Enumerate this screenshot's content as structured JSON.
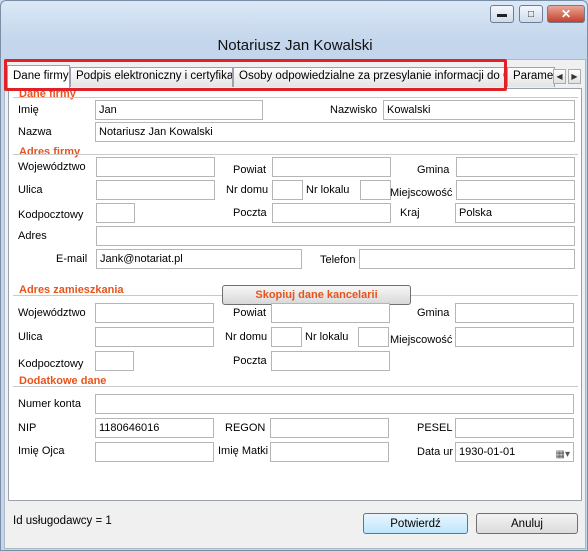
{
  "window": {
    "title": "Notariusz Jan Kowalski",
    "controls": {
      "minimize": "▬",
      "maximize": "□",
      "close": "✕"
    }
  },
  "tabs": [
    {
      "label": "Dane firmy"
    },
    {
      "label": "Podpis elektroniczny i certyfikaty"
    },
    {
      "label": "Osoby odpowiedzialne za przesylanie informacji do GIIF"
    },
    {
      "label": "Paramet"
    }
  ],
  "tab_scroll": {
    "left": "◀",
    "right": "▶"
  },
  "firm": {
    "section": "Dane firmy",
    "imie_label": "Imię",
    "imie_value": "Jan",
    "nazwisko_label": "Nazwisko",
    "nazwisko_value": "Kowalski",
    "nazwa_label": "Nazwa",
    "nazwa_value": "Notariusz Jan Kowalski"
  },
  "firm_address": {
    "section": "Adres firmy",
    "wojewodztwo_label": "Województwo",
    "wojewodztwo_value": "",
    "powiat_label": "Powiat",
    "powiat_value": "",
    "gmina_label": "Gmina",
    "gmina_value": "",
    "ulica_label": "Ulica",
    "ulica_value": "",
    "nr_domu_label": "Nr domu",
    "nr_domu_value": "",
    "nr_lokalu_label": "Nr lokalu",
    "nr_lokalu_value": "",
    "miejscowosc_label": "Miejscowość",
    "miejscowosc_value": "",
    "kodpocztowy_label": "Kodpocztowy",
    "kodpocztowy_value": "",
    "poczta_label": "Poczta",
    "poczta_value": "",
    "kraj_label": "Kraj",
    "kraj_value": "Polska",
    "adres_label": "Adres",
    "adres_value": "",
    "email_label": "E-mail",
    "email_value": "Jank@notariat.pl",
    "telefon_label": "Telefon",
    "telefon_value": ""
  },
  "home_address": {
    "section": "Adres zamieszkania",
    "copy_button": "Skopiuj dane kancelarii",
    "wojewodztwo_label": "Województwo",
    "wojewodztwo_value": "",
    "powiat_label": "Powiat",
    "powiat_value": "",
    "gmina_label": "Gmina",
    "gmina_value": "",
    "ulica_label": "Ulica",
    "ulica_value": "",
    "nr_domu_label": "Nr domu",
    "nr_domu_value": "",
    "nr_lokalu_label": "Nr lokalu",
    "nr_lokalu_value": "",
    "miejscowosc_label": "Miejscowość",
    "miejscowosc_value": "",
    "kodpocztowy_label": "Kodpocztowy",
    "kodpocztowy_value": "",
    "poczta_label": "Poczta",
    "poczta_value": ""
  },
  "extra": {
    "section": "Dodatkowe dane",
    "numer_konta_label": "Numer konta",
    "numer_konta_value": "",
    "nip_label": "NIP",
    "nip_value": "1180646016",
    "regon_label": "REGON",
    "regon_value": "",
    "pesel_label": "PESEL",
    "pesel_value": "",
    "imie_ojca_label": "Imię Ojca",
    "imie_ojca_value": "",
    "imie_matki_label": "Imię Matki",
    "imie_matki_value": "",
    "data_label": "Data ur",
    "data_value": "1930-01-01",
    "date_icon": "▦▾"
  },
  "footer": {
    "id_text": "Id usługodawcy = 1",
    "ok_button": "Potwierdź",
    "cancel_button": "Anuluj"
  }
}
